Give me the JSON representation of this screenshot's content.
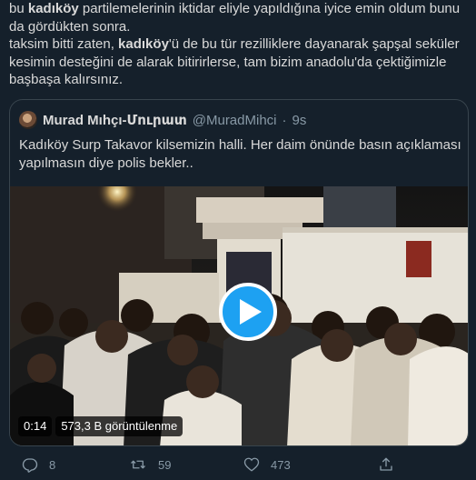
{
  "tweet": {
    "line1_pre": "bu ",
    "line1_bold": "kadıköy",
    "line1_post": " partilemelerinin iktidar eliyle yapıldığına iyice emin oldum bunu",
    "line2": "da gördükten sonra.",
    "line3_pre": "taksim bitti zaten, ",
    "line3_bold": "kadıköy",
    "line3_post": "'ü de bu tür rezilliklere dayanarak şapşal seküler",
    "line4": "kesimin desteğini de alarak bitirirlerse, tam bizim anadolu'da çektiğimizle",
    "line5": "başbaşa kalırsınız."
  },
  "quote": {
    "author_name": "Murad Mıhçı-Մուրատ",
    "author_handle": "@MuradMihci",
    "separator": "·",
    "time": "9s",
    "text_line1": "Kadıköy Surp Takavor kilsemizin halli. Her daim önünde basın açıklaması",
    "text_line2": "yapılmasın diye polis bekler..",
    "video": {
      "duration": "0:14",
      "views": "573,3 B görüntülenme"
    }
  },
  "actions": {
    "reply_count": "8",
    "retweet_count": "59",
    "like_count": "473"
  },
  "colors": {
    "background": "#15202b",
    "text": "#d9d9d9",
    "secondary": "#8899a6",
    "border": "#38444d",
    "accent": "#1da1f2"
  }
}
